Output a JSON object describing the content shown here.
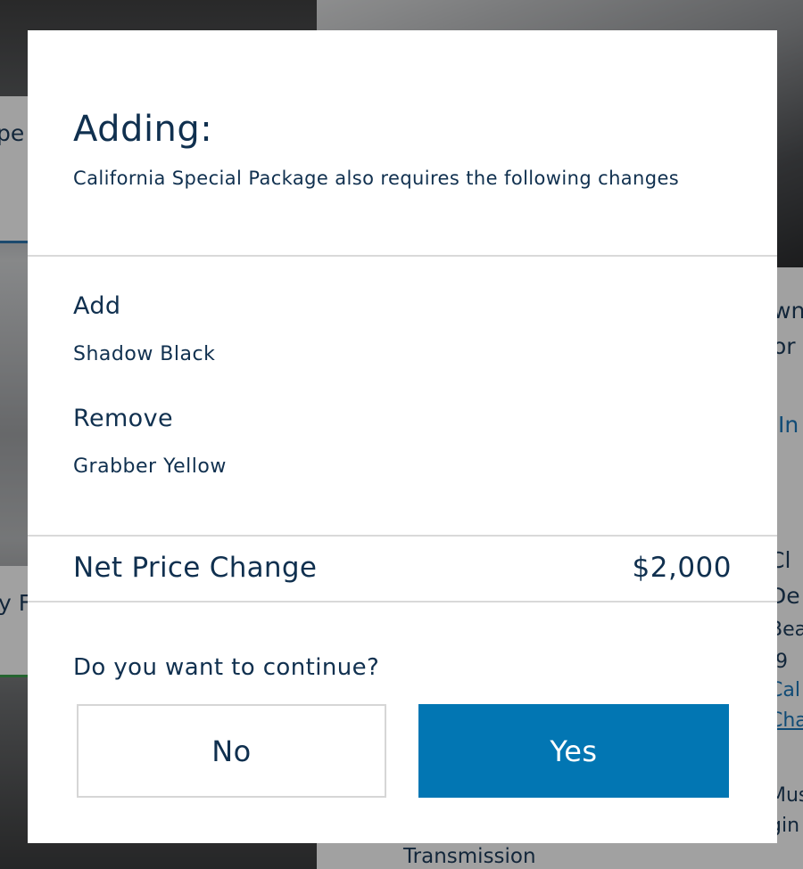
{
  "background": {
    "fragments": [
      {
        "text": "pe",
        "key": "f1"
      },
      {
        "text": "y F",
        "key": "f2"
      },
      {
        "text": "wn",
        "key": "f3"
      },
      {
        "text": "or",
        "key": "f4"
      },
      {
        "text": "In",
        "key": "f5"
      },
      {
        "text": "Cl",
        "key": "f6"
      },
      {
        "text": "De",
        "key": "f7"
      },
      {
        "text": "Bea",
        "key": "f8"
      },
      {
        "text": ".9",
        "key": "f9"
      },
      {
        "text": "Cal",
        "key": "f10"
      },
      {
        "text": "Cha",
        "key": "f11"
      },
      {
        "text": "Mus",
        "key": "f12"
      },
      {
        "text": "gin",
        "key": "f13"
      },
      {
        "text": "Transmission",
        "key": "f14"
      }
    ]
  },
  "modal": {
    "title": "Adding:",
    "subtitle": "California Special Package also requires the following changes",
    "add": {
      "heading": "Add",
      "item": "Shadow Black"
    },
    "remove": {
      "heading": "Remove",
      "item": "Grabber Yellow"
    },
    "net_price": {
      "label": "Net Price Change",
      "value": "$2,000"
    },
    "question": "Do you want to continue?",
    "buttons": {
      "no": "No",
      "yes": "Yes"
    }
  },
  "colors": {
    "primary": "#0276b3",
    "text": "#10304f",
    "divider": "#d9d9d9"
  }
}
